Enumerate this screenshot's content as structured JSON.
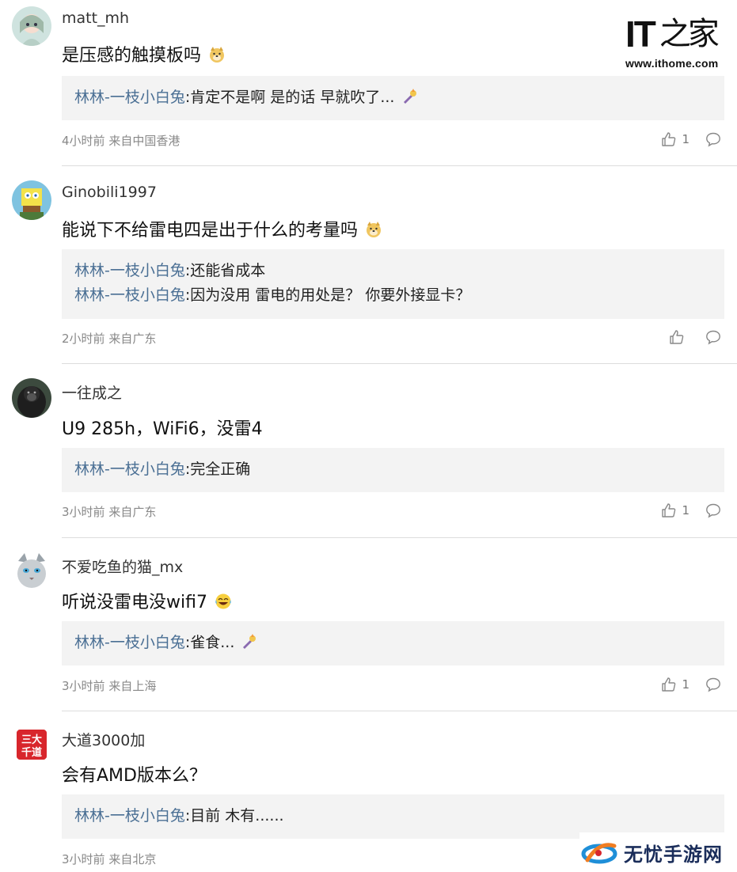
{
  "site_logo": {
    "mark": "IT",
    "mark_zh": "之家",
    "url": "www.ithome.com"
  },
  "watermark": {
    "text": "无忧手游网"
  },
  "comments": [
    {
      "username": "matt_mh",
      "content": "是压感的触摸板吗",
      "emoji": "doge",
      "replies": [
        {
          "user": "林林-一枝小白兔",
          "text": ":肯定不是啊 是的话 早就吹了..."
        }
      ],
      "time": "4小时前",
      "location": "来自中国香港",
      "likes": "1"
    },
    {
      "username": "Ginobili1997",
      "content": "能说下不给雷电四是出于什么的考量吗",
      "emoji": "doge",
      "replies": [
        {
          "user": "林林-一枝小白兔",
          "text": ":还能省成本"
        },
        {
          "user": "林林-一枝小白兔",
          "text": ":因为没用 雷电的用处是？ 你要外接显卡？"
        }
      ],
      "time": "2小时前",
      "location": "来自广东",
      "likes": ""
    },
    {
      "username": "一往成之",
      "content": "U9 285h，WiFi6，没雷4",
      "emoji": "",
      "replies": [
        {
          "user": "林林-一枝小白兔",
          "text": ":完全正确"
        }
      ],
      "time": "3小时前",
      "location": "来自广东",
      "likes": "1"
    },
    {
      "username": "不爱吃鱼的猫_mx",
      "content": "听说没雷电没wifi7",
      "emoji": "laugh",
      "replies": [
        {
          "user": "林林-一枝小白兔",
          "text": ":雀食..."
        }
      ],
      "time": "3小时前",
      "location": "来自上海",
      "likes": "1"
    },
    {
      "username": "大道3000加",
      "content": "会有AMD版本么？",
      "emoji": "",
      "replies": [
        {
          "user": "林林-一枝小白兔",
          "text": ":目前 木有......"
        }
      ],
      "time": "3小时前",
      "location": "来自北京",
      "likes": ""
    }
  ],
  "avatar_badge_text": "三大千道"
}
